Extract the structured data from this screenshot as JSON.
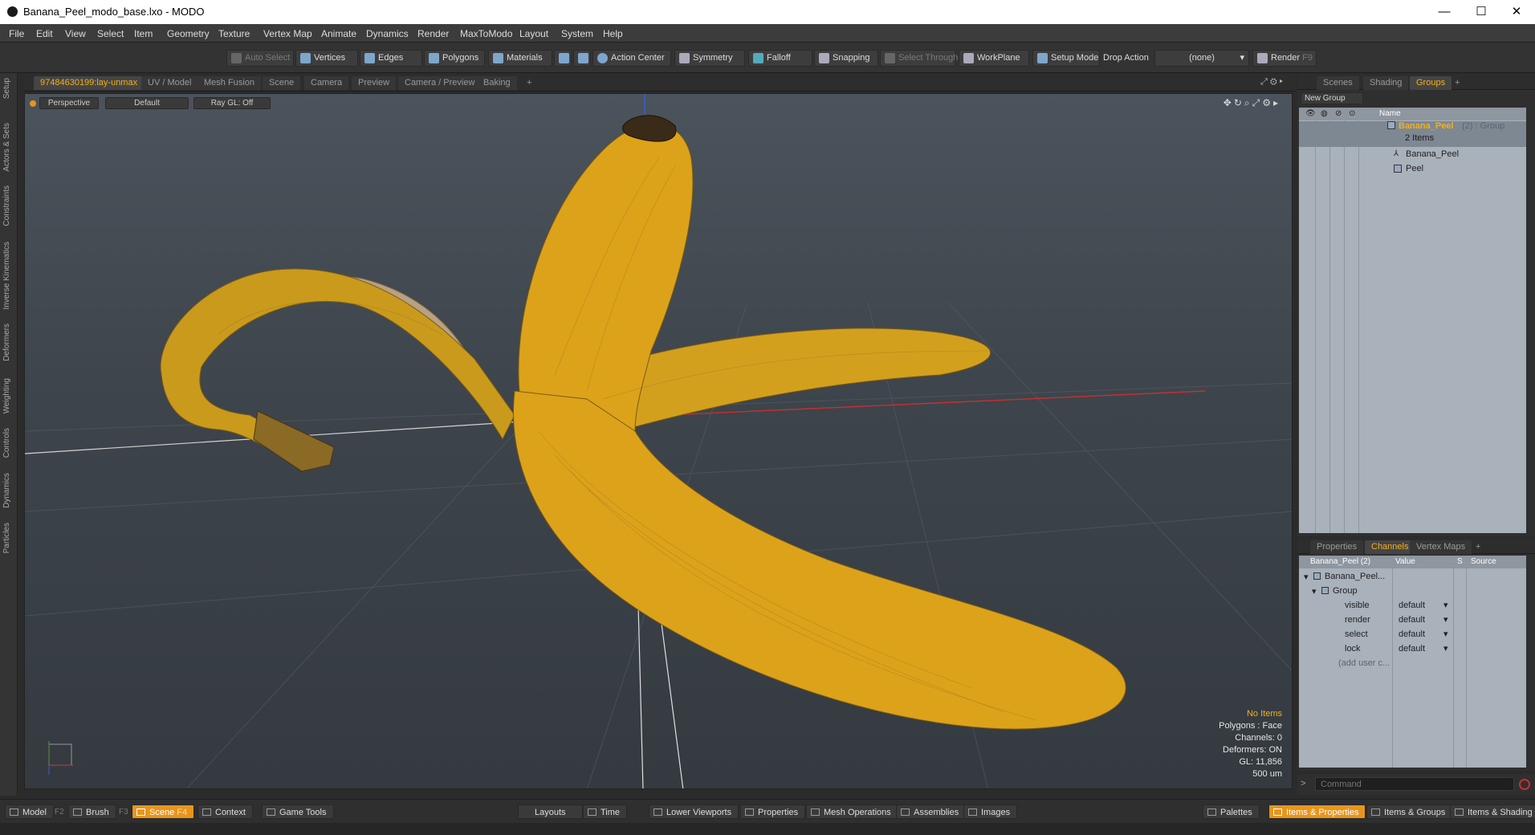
{
  "window": {
    "title": "Banana_Peel_modo_base.lxo - MODO",
    "minimize": "—",
    "maximize": "☐",
    "close": "✕"
  },
  "menu": [
    "File",
    "Edit",
    "View",
    "Select",
    "Item",
    "Geometry",
    "Texture",
    "Vertex Map",
    "Animate",
    "Dynamics",
    "Render",
    "MaxToModo",
    "Layout",
    "System",
    "Help"
  ],
  "toolbar": {
    "auto_select": "Auto Select",
    "vertices": "Vertices",
    "edges": "Edges",
    "polygons": "Polygons",
    "materials": "Materials",
    "action_center": "Action Center",
    "symmetry": "Symmetry",
    "falloff": "Falloff",
    "snapping": "Snapping",
    "select_through": "Select Through",
    "workplane": "WorkPlane",
    "setup_mode": "Setup Mode",
    "drop_action": "Drop Action",
    "drop_value": "(none)",
    "render": "Render",
    "render_key": "F9"
  },
  "left_tabs": [
    "Setup",
    "Actors & Sets",
    "Constraints",
    "Inverse Kinematics",
    "Deformers",
    "Weighting",
    "Controls",
    "Dynamics",
    "Particles"
  ],
  "viewport_tabs": [
    "97484630199:lay-unmax",
    "UV / Model",
    "Mesh Fusion",
    "Scene",
    "Camera",
    "Preview",
    "Camera / Preview",
    "Baking",
    "+"
  ],
  "viewport": {
    "perspective": "Perspective",
    "shading": "Default",
    "raygl": "Ray GL: Off",
    "info": {
      "selection": "No Items",
      "polygons": "Polygons : Face",
      "channels": "Channels: 0",
      "deformers": "Deformers: ON",
      "gl": "GL: 11,856",
      "scale": "500 um"
    }
  },
  "groups_panel": {
    "tabs": [
      "Scenes",
      "Shading",
      "Groups",
      "+"
    ],
    "new_group": "New Group",
    "col_name": "Name",
    "root": {
      "name": "Banana_Peel",
      "suffix": "(2) : Group",
      "count": "2 Items"
    },
    "children": [
      "Banana_Peel",
      "Peel"
    ]
  },
  "channels_panel": {
    "tabs": [
      "Properties",
      "Channels",
      "Vertex Maps",
      "+"
    ],
    "header": {
      "name": "Banana_Peel (2)",
      "value": "Value",
      "s": "S",
      "source": "Source"
    },
    "tree": {
      "root": "Banana_Peel...",
      "group": "Group"
    },
    "rows": [
      {
        "name": "visible",
        "value": "default"
      },
      {
        "name": "render",
        "value": "default"
      },
      {
        "name": "select",
        "value": "default"
      },
      {
        "name": "lock",
        "value": "default"
      }
    ],
    "add_user": "(add user c..."
  },
  "command": {
    "placeholder": "Command",
    "prompt": ">"
  },
  "bottom_bar": {
    "model": "Model",
    "model_key": "F2",
    "brush": "Brush",
    "brush_key": "F3",
    "scene": "Scene",
    "scene_key": "F4",
    "context": "Context",
    "game_tools": "Game Tools",
    "layouts": "Layouts",
    "time": "Time",
    "lower_viewports": "Lower Viewports",
    "properties": "Properties",
    "mesh_operations": "Mesh Operations",
    "assemblies": "Assemblies",
    "images": "Images",
    "palettes": "Palettes",
    "items_properties": "Items & Properties",
    "items_groups": "Items & Groups",
    "items_shading": "Items & Shading"
  },
  "colors": {
    "accent": "#f3b01a",
    "banana": "#dca21a",
    "bg": "#2b2b2b"
  }
}
